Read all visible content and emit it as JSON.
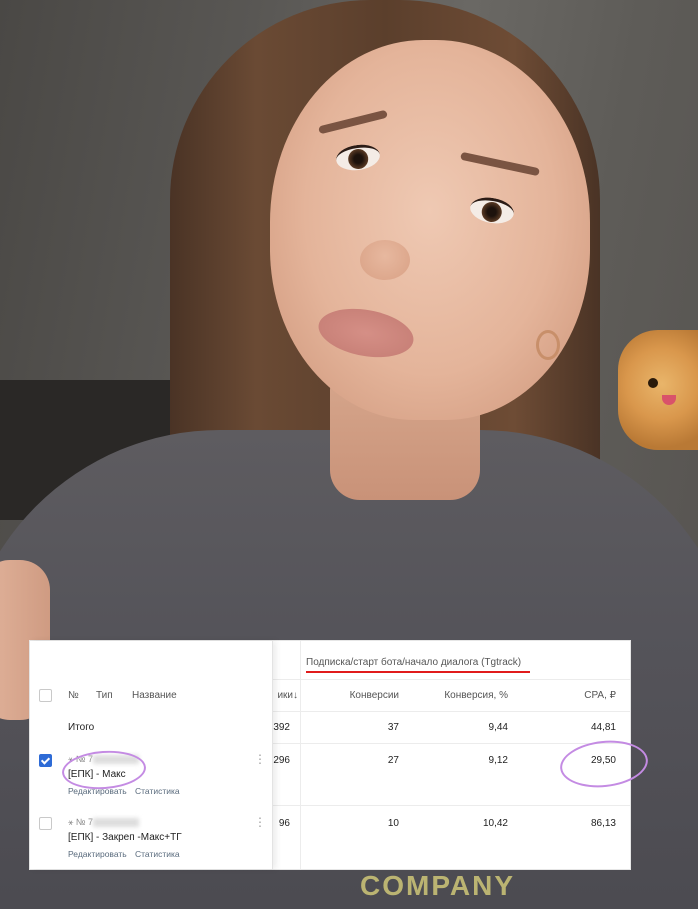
{
  "table": {
    "group_title": "Подписка/старт бота/начало диалога (Tgtrack)",
    "headers": {
      "number": "№",
      "type": "Тип",
      "name": "Название",
      "clicks": "ики↓",
      "conversions": "Конверсии",
      "conversion_rate": "Конверсия, %",
      "cpa": "CPA, ₽"
    },
    "total": {
      "label": "Итого",
      "clicks": "392",
      "conversions": "37",
      "conversion_rate": "9,44",
      "cpa": "44,81"
    },
    "rows": [
      {
        "checked": true,
        "id_prefix": "№ 7",
        "name": "[ЕПК] - Макс",
        "edit_link": "Редактировать",
        "stats_link": "Статистика",
        "clicks": "296",
        "conversions": "27",
        "conversion_rate": "9,12",
        "cpa": "29,50"
      },
      {
        "checked": false,
        "id_prefix": "№ 7",
        "name": "[ЕПК] - Закреп -Макс+ТГ",
        "edit_link": "Редактировать",
        "stats_link": "Статистика",
        "clicks": "96",
        "conversions": "10",
        "conversion_rate": "10,42",
        "cpa": "86,13"
      }
    ]
  },
  "photo": {
    "shirt_text": "COMPANY"
  },
  "colors": {
    "accent_underline": "#e11b1b",
    "highlight_ring": "#c48be3",
    "checkbox_checked": "#2e6bd6"
  }
}
